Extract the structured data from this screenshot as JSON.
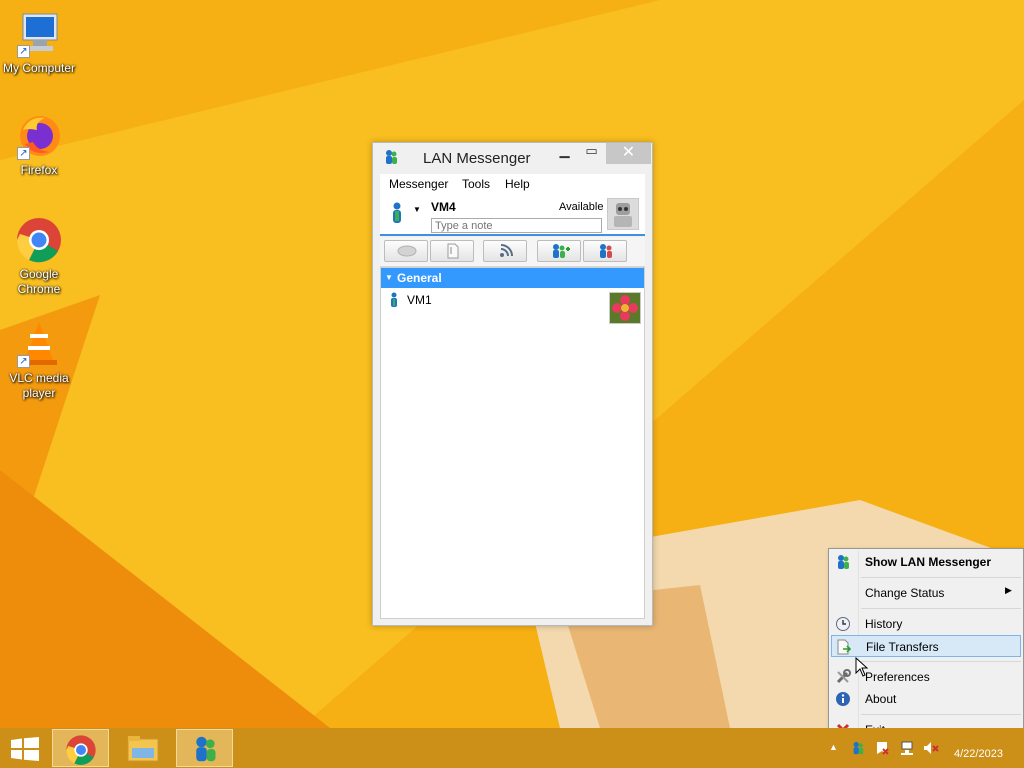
{
  "desktop": {
    "icons": [
      {
        "label": "My Computer"
      },
      {
        "label": "Firefox"
      },
      {
        "label": "Google Chrome"
      },
      {
        "label": "VLC media player"
      }
    ]
  },
  "window": {
    "title": "LAN Messenger",
    "menus": [
      "Messenger",
      "Tools",
      "Help"
    ],
    "user": {
      "name": "VM4",
      "status": "Available",
      "note_placeholder": "Type a note"
    },
    "toolbar_icons": [
      "chat-icon",
      "file-icon",
      "broadcast-icon",
      "add-contact-icon",
      "remove-contact-icon"
    ],
    "group": {
      "name": "General",
      "contacts": [
        {
          "name": "VM1"
        }
      ]
    }
  },
  "context_menu": {
    "items": [
      {
        "label": "Show LAN Messenger",
        "icon": "messenger-icon"
      },
      {
        "label": "Change Status",
        "icon": ""
      },
      {
        "label": "History",
        "icon": "history-icon"
      },
      {
        "label": "File Transfers",
        "icon": "file-transfer-icon"
      },
      {
        "label": "Preferences",
        "icon": "preferences-icon"
      },
      {
        "label": "About",
        "icon": "info-icon"
      },
      {
        "label": "Exit",
        "icon": "exit-icon"
      }
    ]
  },
  "taskbar": {
    "apps": [
      "start-icon",
      "chrome-icon",
      "file-explorer-icon",
      "lan-messenger-icon"
    ],
    "date": "4/22/2023"
  },
  "colors": {
    "wallpaper": "#f6b013",
    "accent": "#3399ff",
    "taskbar": "#cc8f18"
  }
}
